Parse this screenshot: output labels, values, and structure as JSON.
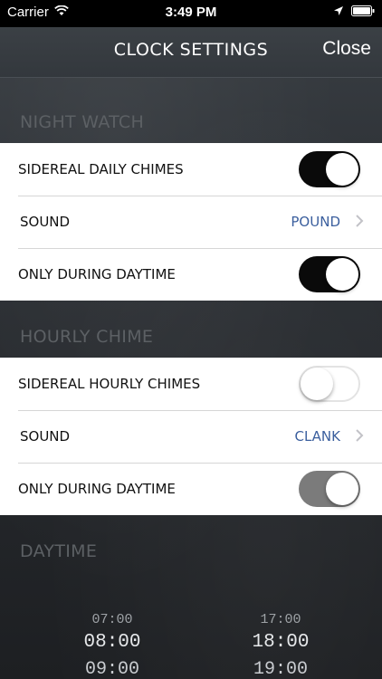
{
  "status_bar": {
    "carrier": "Carrier",
    "time": "3:49 PM",
    "icons": [
      "wifi-icon",
      "location-icon",
      "battery-icon"
    ]
  },
  "nav": {
    "title": "CLOCK SETTINGS",
    "close_label": "Close"
  },
  "sections": {
    "night_watch": {
      "header": "NIGHT WATCH",
      "daily_chimes_label": "SIDEREAL DAILY CHIMES",
      "daily_chimes_state": "on",
      "sound_label": "SOUND",
      "sound_value": "POUND",
      "daytime_label": "ONLY DURING DAYTIME",
      "daytime_state": "on"
    },
    "hourly_chime": {
      "header": "HOURLY CHIME",
      "hourly_chimes_label": "SIDEREAL HOURLY CHIMES",
      "hourly_chimes_state": "off",
      "sound_label": "SOUND",
      "sound_value": "CLANK",
      "daytime_label": "ONLY DURING DAYTIME",
      "daytime_state": "on (disabled)"
    },
    "daytime": {
      "header": "DAYTIME",
      "start_picker": [
        "07:00",
        "08:00",
        "09:00"
      ],
      "end_picker": [
        "17:00",
        "18:00",
        "19:00"
      ]
    }
  },
  "colors": {
    "switch_on": "#0a0a0a",
    "switch_disabled": "#7b7b7b",
    "value_text": "#3b5f9e",
    "section_header": "#5c6064"
  }
}
